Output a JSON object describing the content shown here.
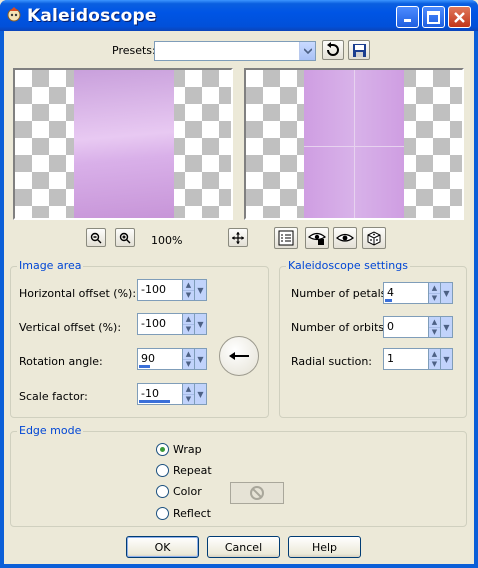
{
  "window": {
    "title": "Kaleidoscope",
    "controls": [
      "minimize-icon",
      "maximize-icon",
      "close-icon"
    ]
  },
  "presets": {
    "label": "Presets:",
    "value": ""
  },
  "preview": {
    "zoom": "100%",
    "source_color": "#dcb7ea",
    "result_color": "#d8aee8"
  },
  "image_area": {
    "title": "Image area",
    "horizontal_offset": {
      "label": "Horizontal offset (%):",
      "value": "-100"
    },
    "vertical_offset": {
      "label": "Vertical offset (%):",
      "value": "-100"
    },
    "rotation_angle": {
      "label": "Rotation angle:",
      "value": "90",
      "level": 0.25
    },
    "scale_factor": {
      "label": "Scale factor:",
      "value": "-10",
      "level": 0.7
    }
  },
  "kaleidoscope_settings": {
    "title": "Kaleidoscope settings",
    "number_of_petals": {
      "label": "Number of petals:",
      "value": "4",
      "level": 0.15
    },
    "number_of_orbits": {
      "label": "Number of orbits:",
      "value": "0"
    },
    "radial_suction": {
      "label": "Radial suction:",
      "value": "1"
    }
  },
  "edge_mode": {
    "title": "Edge mode",
    "options": [
      "Wrap",
      "Repeat",
      "Color",
      "Reflect"
    ],
    "selected": "Wrap"
  },
  "footer": {
    "ok": "OK",
    "cancel": "Cancel",
    "help": "Help"
  },
  "colors": {
    "titlebar": "#0055e5",
    "face": "#ece9d8",
    "group_title": "#0046d5"
  }
}
